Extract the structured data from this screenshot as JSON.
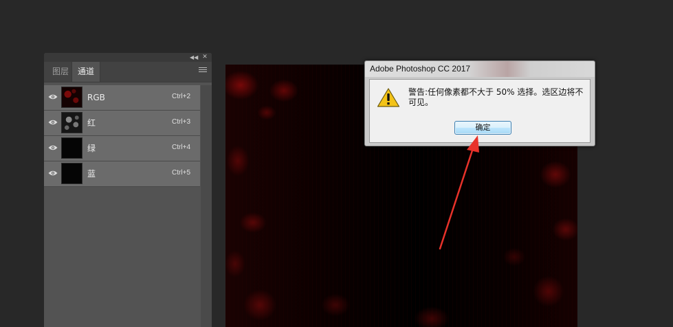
{
  "panel": {
    "tabs": [
      {
        "label": "图层",
        "active": false
      },
      {
        "label": "通道",
        "active": true
      }
    ],
    "channels": [
      {
        "name": "RGB",
        "shortcut": "Ctrl+2",
        "visible": true
      },
      {
        "name": "红",
        "shortcut": "Ctrl+3",
        "visible": true
      },
      {
        "name": "绿",
        "shortcut": "Ctrl+4",
        "visible": true
      },
      {
        "name": "蓝",
        "shortcut": "Ctrl+5",
        "visible": true
      }
    ],
    "icons": [
      "collapse-icon",
      "close-icon",
      "menu-icon",
      "eye-icon"
    ]
  },
  "dialog": {
    "title": "Adobe Photoshop CC 2017",
    "message": "警告:任何像素都不大于 50% 选择。选区边将不可见。",
    "ok_label": "确定",
    "icon": "warning-icon"
  },
  "colors": {
    "annotation_arrow": "#e8322a",
    "canvas_accent": "#8a0a0a",
    "ok_button_border": "#3c7fb1"
  }
}
